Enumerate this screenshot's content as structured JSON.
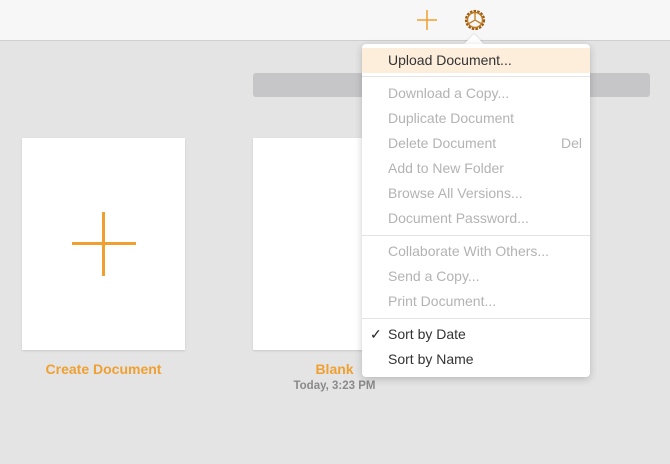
{
  "toolbar": {
    "add_icon": "plus-icon",
    "settings_icon": "gear-icon"
  },
  "documents": [
    {
      "title": "Create Document"
    },
    {
      "title": "Blank",
      "date": "Today, 3:23 PM"
    }
  ],
  "menu": {
    "upload": "Upload Document...",
    "download": "Download a Copy...",
    "duplicate": "Duplicate Document",
    "delete": "Delete Document",
    "delete_shortcut": "Del",
    "add_folder": "Add to New Folder",
    "versions": "Browse All Versions...",
    "password": "Document Password...",
    "collaborate": "Collaborate With Others...",
    "send": "Send a Copy...",
    "print": "Print Document...",
    "sort_date": "Sort by Date",
    "sort_name": "Sort by Name",
    "check": "✓"
  },
  "colors": {
    "accent": "#f0a030"
  }
}
